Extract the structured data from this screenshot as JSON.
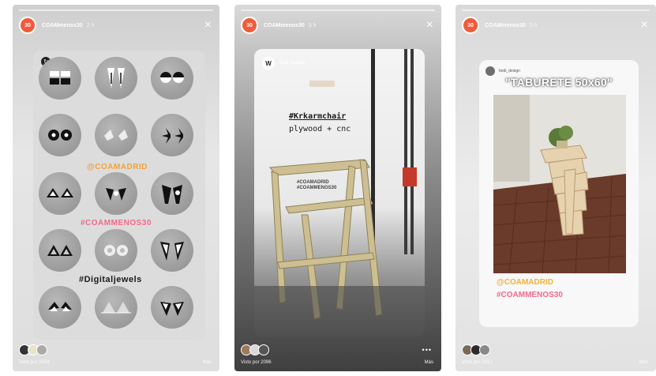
{
  "stories": [
    {
      "username": "COAMmenos30",
      "time": "2 h",
      "avatar_text": "30",
      "hashtags": [
        "@COAMADRID",
        "#COAMMENOS30",
        "#Digitaljewels"
      ],
      "seen_text": "Visto por 2259",
      "highlight_label": "Más"
    },
    {
      "username": "COAMmenos30",
      "time": "3 h",
      "avatar_text": "30",
      "repost_user": "bodi_design",
      "repost_avatar_text": "W",
      "captions": [
        "#Krkarmchair",
        "plywood + cnc"
      ],
      "mini_tags": [
        "#COAMADRID",
        "#COAMMENOS30"
      ],
      "seen_text": "Visto por 2096",
      "more_label": "•••",
      "highlight_label": "Más"
    },
    {
      "username": "COAMmenos30",
      "time": "3 h",
      "avatar_text": "30",
      "repost_user": "bodi_design",
      "title": "\"TABURETE 50x60\"",
      "hashtags": [
        "@COAMADRID",
        "#COAMMENOS30"
      ],
      "seen_text": "Visto por 2017",
      "highlight_label": "Más"
    }
  ],
  "colors": {
    "avatar": "#f25a3a",
    "hashtag_orange": "#f2a23a",
    "hashtag_pink": "#f26a8a"
  },
  "icons": {
    "close": "×",
    "repost": "↻"
  }
}
